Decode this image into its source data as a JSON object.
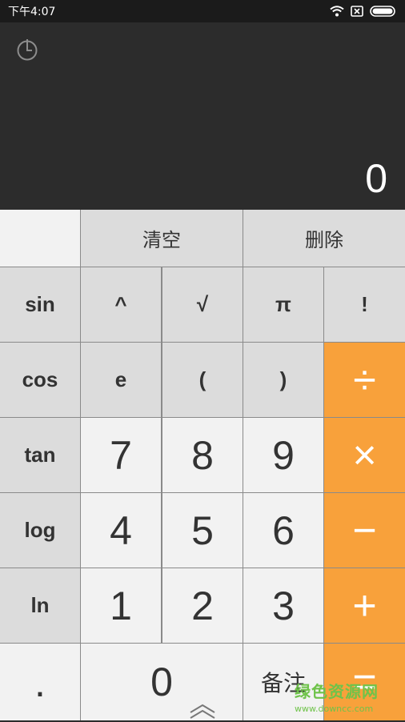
{
  "status": {
    "time": "下午4:07"
  },
  "display": {
    "result": "0"
  },
  "keys": {
    "clear": "清空",
    "delete": "删除",
    "sin": "sin",
    "pow": "^",
    "sqrt": "√",
    "pi": "π",
    "fact": "!",
    "cos": "cos",
    "e": "e",
    "lparen": "(",
    "rparen": ")",
    "div": "÷",
    "tan": "tan",
    "seven": "7",
    "eight": "8",
    "nine": "9",
    "mul": "×",
    "log": "log",
    "four": "4",
    "five": "5",
    "six": "6",
    "sub": "−",
    "ln": "ln",
    "one": "1",
    "two": "2",
    "three": "3",
    "add": "+",
    "dot": ".",
    "zero": "0",
    "note": "备注",
    "eq": "="
  },
  "watermark": {
    "main": "绿色资源网",
    "url": "www.downcc.com"
  },
  "colors": {
    "orange": "#f8a13b",
    "display_bg": "#2c2c2c"
  }
}
